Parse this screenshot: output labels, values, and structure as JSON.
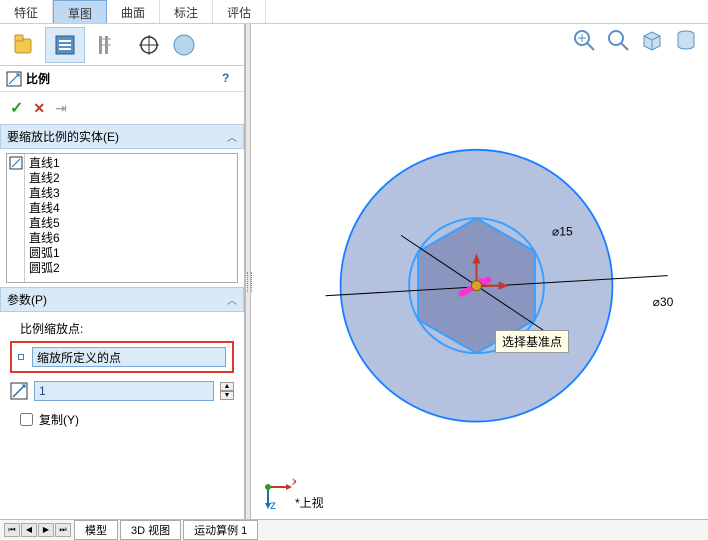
{
  "tabs": {
    "feature": "特征",
    "sketch": "草图",
    "surface": "曲面",
    "annot": "标注",
    "eval": "评估"
  },
  "title": "比例",
  "help": "?",
  "actions": {
    "ok": "✓",
    "cancel": "✕",
    "pin": "⇥"
  },
  "sections": {
    "entities": "要缩放比例的实体(E)",
    "params": "参数(P)"
  },
  "entity_list": [
    "直线1",
    "直线2",
    "直线3",
    "直线4",
    "直线5",
    "直线6",
    "圆弧1",
    "圆弧2"
  ],
  "param_label": "比例缩放点:",
  "point_value": "缩放所定义的点",
  "scale_value": "1",
  "copy_label": "复制(Y)",
  "tooltip": "选择基准点",
  "viewlabel": "*上视",
  "dims": {
    "d15": "⌀15",
    "d30": "⌀30"
  },
  "bottom": {
    "model": "模型",
    "view3d": "3D 视图",
    "motion": "运动算例 1"
  },
  "triad": {
    "x": "x",
    "z": "z"
  }
}
